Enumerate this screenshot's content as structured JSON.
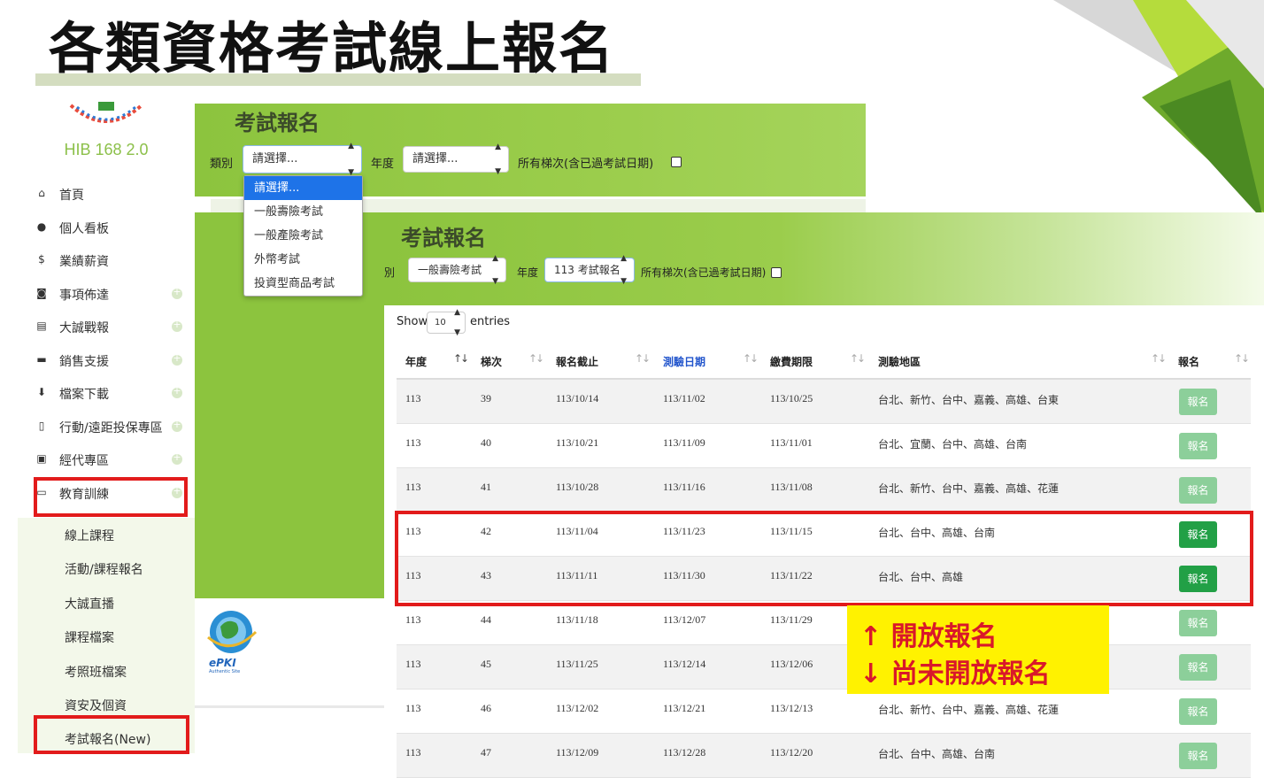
{
  "slide": {
    "title": "各類資格考試線上報名"
  },
  "sidebar": {
    "logo_text": "HIB 168 2.0",
    "menu": [
      {
        "icon": "home-icon",
        "glyph": "⌂",
        "label": "首頁",
        "has_plus": false
      },
      {
        "icon": "user-icon",
        "glyph": "●",
        "label": "個人看板",
        "has_plus": false
      },
      {
        "icon": "dollar-icon",
        "glyph": "$",
        "label": "業績薪資",
        "has_plus": false
      },
      {
        "icon": "camera-icon",
        "glyph": "◙",
        "label": "事項佈達",
        "has_plus": true
      },
      {
        "icon": "newspaper-icon",
        "glyph": "▤",
        "label": "大誠戰報",
        "has_plus": true
      },
      {
        "icon": "briefcase-icon",
        "glyph": "▬",
        "label": "銷售支援",
        "has_plus": true
      },
      {
        "icon": "download-icon",
        "glyph": "⬇",
        "label": "檔案下載",
        "has_plus": true
      },
      {
        "icon": "mobile-icon",
        "glyph": "▯",
        "label": "行動/遠距投保專區",
        "has_plus": true
      },
      {
        "icon": "money-icon",
        "glyph": "▣",
        "label": "經代專區",
        "has_plus": true
      },
      {
        "icon": "laptop-icon",
        "glyph": "▭",
        "label": "教育訓練",
        "has_plus": true
      }
    ],
    "submenu": [
      "線上課程",
      "活動/課程報名",
      "大誠直播",
      "課程檔案",
      "考照班檔案",
      "資安及個資",
      "考試報名(New)"
    ]
  },
  "panel1": {
    "title": "考試報名",
    "category_label": "類別",
    "category_value": "請選擇...",
    "year_label": "年度",
    "year_value": "請選擇...",
    "all_sessions_label": "所有梯次(含已過考試日期)",
    "dropdown_options": [
      "請選擇...",
      "一般壽險考試",
      "一般產險考試",
      "外幣考試",
      "投資型商品考試"
    ]
  },
  "panel2": {
    "title": "考試報名",
    "category_label": "類別",
    "category_value": "一般壽險考試",
    "year_label": "年度",
    "year_value": "113 考試報名",
    "all_sessions_label": "所有梯次(含已過考試日期)"
  },
  "table": {
    "show_label": "Show",
    "page_size": "10",
    "entries_label": "entries",
    "headers": [
      "年度",
      "梯次",
      "報名截止",
      "測驗日期",
      "繳費期限",
      "測驗地區",
      "報名"
    ],
    "sort_icons": [
      "↑↓",
      "↑↓",
      "↑↓",
      "↑↓",
      "↑↓",
      "↑↓",
      "↑↓"
    ],
    "rows": [
      {
        "year": "113",
        "session": "39",
        "deadline": "113/10/14",
        "exam_date": "113/11/02",
        "pay_due": "113/10/25",
        "area": "台北、新竹、台中、嘉義、高雄、台東",
        "btn": "報名",
        "open": false
      },
      {
        "year": "113",
        "session": "40",
        "deadline": "113/10/21",
        "exam_date": "113/11/09",
        "pay_due": "113/11/01",
        "area": "台北、宜蘭、台中、高雄、台南",
        "btn": "報名",
        "open": false
      },
      {
        "year": "113",
        "session": "41",
        "deadline": "113/10/28",
        "exam_date": "113/11/16",
        "pay_due": "113/11/08",
        "area": "台北、新竹、台中、嘉義、高雄、花蓮",
        "btn": "報名",
        "open": false
      },
      {
        "year": "113",
        "session": "42",
        "deadline": "113/11/04",
        "exam_date": "113/11/23",
        "pay_due": "113/11/15",
        "area": "台北、台中、高雄、台南",
        "btn": "報名",
        "open": true
      },
      {
        "year": "113",
        "session": "43",
        "deadline": "113/11/11",
        "exam_date": "113/11/30",
        "pay_due": "113/11/22",
        "area": "台北、台中、高雄",
        "btn": "報名",
        "open": true
      },
      {
        "year": "113",
        "session": "44",
        "deadline": "113/11/18",
        "exam_date": "113/12/07",
        "pay_due": "113/11/29",
        "area": "",
        "btn": "報名",
        "open": false
      },
      {
        "year": "113",
        "session": "45",
        "deadline": "113/11/25",
        "exam_date": "113/12/14",
        "pay_due": "113/12/06",
        "area": "",
        "btn": "報名",
        "open": false
      },
      {
        "year": "113",
        "session": "46",
        "deadline": "113/12/02",
        "exam_date": "113/12/21",
        "pay_due": "113/12/13",
        "area": "台北、新竹、台中、嘉義、高雄、花蓮",
        "btn": "報名",
        "open": false
      },
      {
        "year": "113",
        "session": "47",
        "deadline": "113/12/09",
        "exam_date": "113/12/28",
        "pay_due": "113/12/20",
        "area": "台北、台中、高雄、台南",
        "btn": "報名",
        "open": false
      }
    ]
  },
  "note": {
    "line1": "↑ 開放報名",
    "line2": "↓ 尚未開放報名"
  },
  "badge": {
    "epki_text": "ePKI",
    "epki_sub": "Authentic Site"
  },
  "colors": {
    "brand_green": "#8cc43e",
    "open_button": "#22a046",
    "closed_button": "#8ccf9a",
    "highlight_red": "#e21b1b",
    "note_yellow": "#fff200"
  }
}
